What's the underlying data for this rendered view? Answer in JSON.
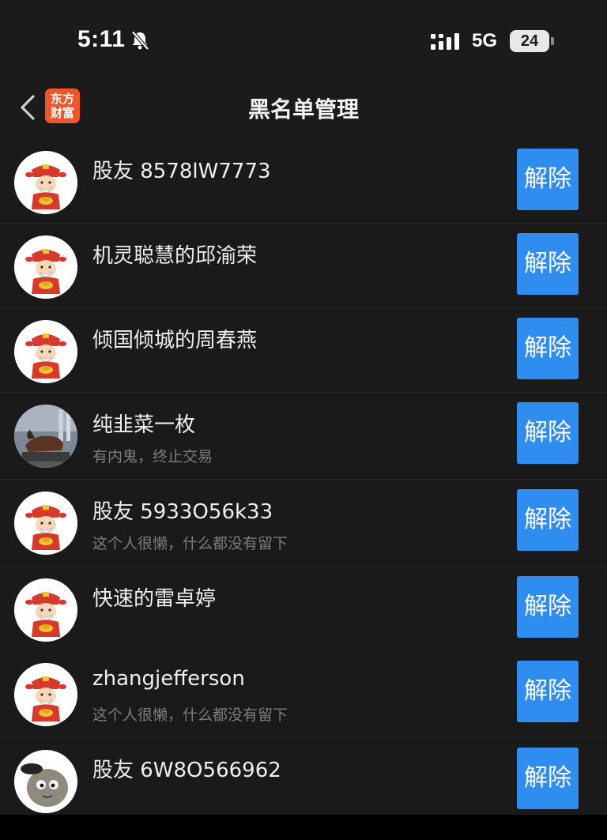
{
  "status_bar": {
    "time": "5:11",
    "network": "5G",
    "battery": "24"
  },
  "nav": {
    "title": "黑名单管理",
    "logo_line1": "东方",
    "logo_line2": "财富"
  },
  "button_label": "解除",
  "users": [
    {
      "name": "股友 8578lW7773",
      "sub": "",
      "avatar": "fortune-god-avatar"
    },
    {
      "name": "机灵聪慧的邱渝荣",
      "sub": "",
      "avatar": "fortune-god-avatar"
    },
    {
      "name": "倾国倾城的周春燕",
      "sub": "",
      "avatar": "fortune-god-avatar"
    },
    {
      "name": "纯韭菜一枚",
      "sub": "有内鬼，终止交易",
      "avatar": "bull-photo-avatar"
    },
    {
      "name": "股友 5933O56k33",
      "sub": "这个人很懒，什么都没有留下",
      "avatar": "fortune-god-avatar"
    },
    {
      "name": "快速的雷卓婷",
      "sub": "",
      "avatar": "fortune-god-avatar"
    },
    {
      "name": "zhangjefferson",
      "sub": "这个人很懒，什么都没有留下",
      "avatar": "fortune-god-avatar"
    },
    {
      "name": "股友 6W8O566962",
      "sub": "",
      "avatar": "potato-cartoon-avatar"
    }
  ],
  "colors": {
    "accent": "#2f8df0",
    "logo": "#f0562a",
    "background": "#161616"
  }
}
